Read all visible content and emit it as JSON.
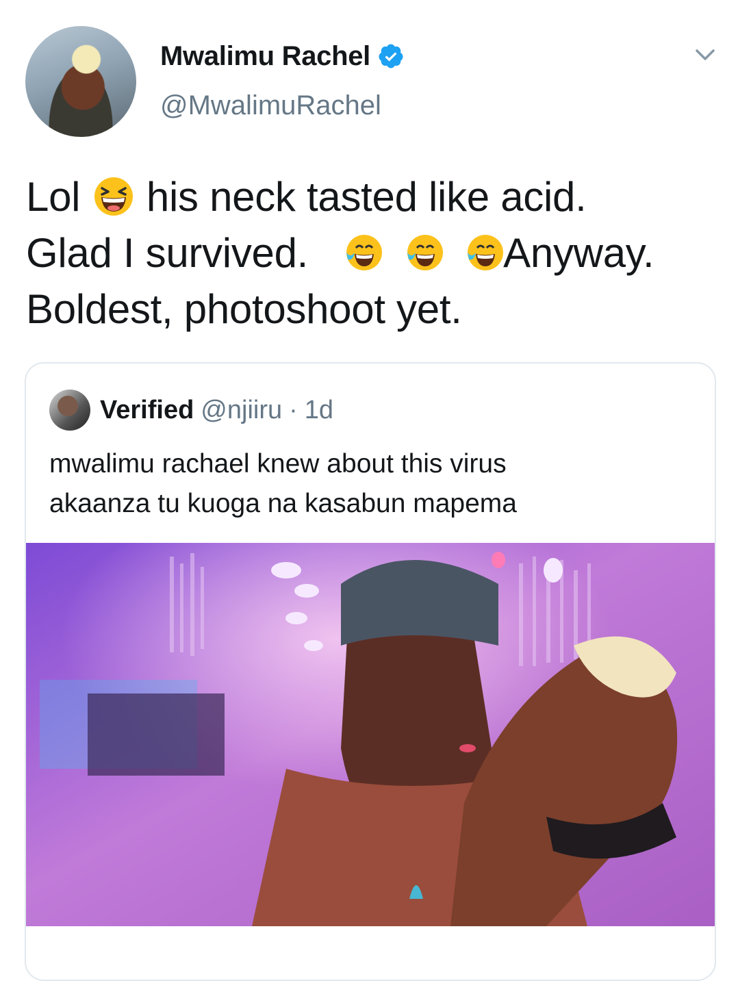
{
  "tweet": {
    "author_name": "Mwalimu Rachel",
    "author_handle": "@MwalimuRachel",
    "text_line1_a": "Lol",
    "text_line1_b": "his neck tasted like acid.",
    "text_line2_a": "Glad I survived.",
    "text_line2_b": "Anyway.",
    "text_line3": "Boldest, photoshoot yet."
  },
  "quoted_tweet": {
    "author_name": "Verified",
    "author_handle": "@njiiru",
    "separator": "·",
    "time": "1d",
    "text_line1": "mwalimu rachael knew about this virus",
    "text_line2": "akaanza tu kuoga na kasabun mapema"
  },
  "icons": {
    "verified": "verified-badge-icon",
    "menu": "chevron-down-icon",
    "laughing": "grinning-squinting-face-emoji",
    "tears": "face-with-tears-of-joy-emoji"
  },
  "colors": {
    "verified_blue": "#1da1f2",
    "secondary_text": "#657786",
    "border": "#e1e8ed"
  }
}
